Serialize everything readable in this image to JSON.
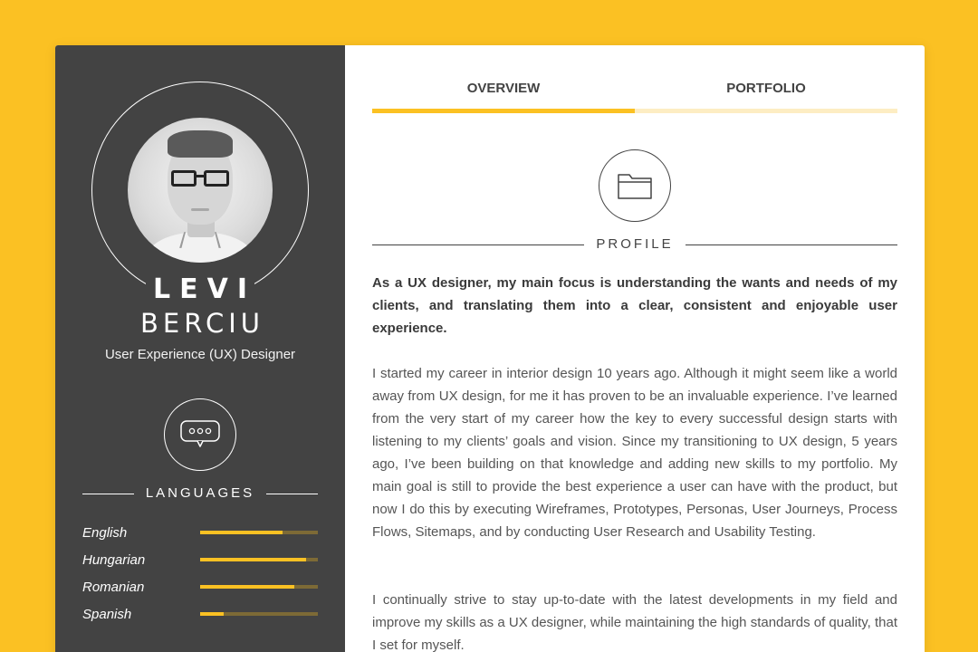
{
  "profile": {
    "first_name": "LEVI",
    "last_name": "BERCIU",
    "job_title": "User Experience (UX) Designer",
    "avatar_icon": "profile-photo"
  },
  "languages": {
    "heading": "LANGUAGES",
    "icon": "chat-bubble-icon",
    "items": [
      {
        "name": "English",
        "level": 0.7
      },
      {
        "name": "Hungarian",
        "level": 0.9
      },
      {
        "name": "Romanian",
        "level": 0.8
      },
      {
        "name": "Spanish",
        "level": 0.2
      }
    ]
  },
  "tabs": [
    {
      "label": "OVERVIEW",
      "active": true
    },
    {
      "label": "PORTFOLIO",
      "active": false
    }
  ],
  "profile_section": {
    "heading": "PROFILE",
    "icon": "folder-icon",
    "intro": "As a UX designer, my main focus is understanding the wants and needs of my clients, and translating them into a clear, consistent and enjoyable user experience.",
    "paragraph_1": "I started my career in interior design 10 years ago. Although it might seem like a world away from UX design, for me it has proven to be an invaluable experience. I’ve learned from the very start of my career how the key to every successful design starts with listening to my clients’ goals and vision. Since my transitioning to UX design, 5 years ago, I’ve been building on that knowledge and adding new skills to my portfolio. My main goal is still to provide the best experience a user can have with the product, but now I do this by executing Wireframes, Prototypes, Personas, User Journeys, Process Flows, Sitemaps, and by conducting User Research and Usability Testing.",
    "paragraph_2": "I continually strive to stay up-to-date with the latest developments in my field and improve my skills as a UX designer, while maintaining the high standards of quality, that I set for myself."
  },
  "colors": {
    "accent": "#FBC123",
    "accent_light": "#FDEDC3",
    "sidebar_bg": "#434343",
    "track": "#7d6a36"
  }
}
